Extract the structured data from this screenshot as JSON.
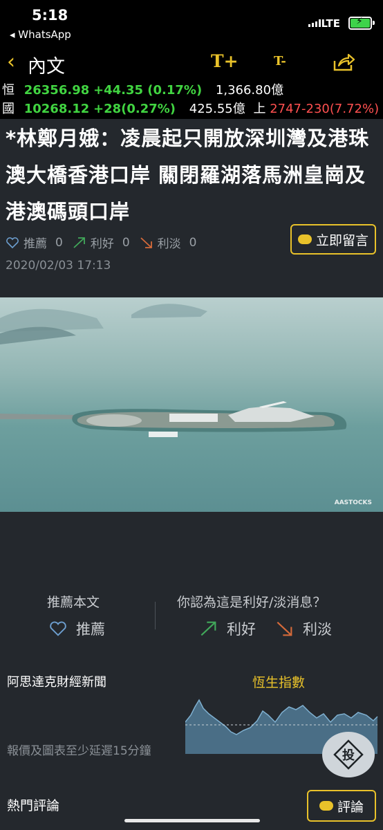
{
  "status_bar": {
    "time": "5:18",
    "back_app": "◂ WhatsApp",
    "network": "LTE"
  },
  "nav": {
    "back_glyph": "‹",
    "title": "內文",
    "font_larger": "T+",
    "font_smaller": "T-"
  },
  "ticker": {
    "hsi_label": "恒",
    "hsi_value": "26356.98",
    "hsi_change": "+44.35 (0.17%)",
    "hsi_turnover": "1,366.80億",
    "hscei_label": "國",
    "hscei_value": "10268.12",
    "hscei_change": "+28(0.27%)",
    "hscei_turnover": "425.55億",
    "sh_label": "上",
    "sh_value": "2747-230(7.72%)"
  },
  "article": {
    "headline": "*林鄭月娥：凌晨起只開放深圳灣及港珠澳大橋香港口岸 關閉羅湖落馬洲皇崗及港澳碼頭口岸",
    "recommend_label": "推薦",
    "recommend_count": "0",
    "bullish_label": "利好",
    "bullish_count": "0",
    "bearish_label": "利淡",
    "bearish_count": "0",
    "date": "2020/02/03 17:13",
    "comment_button": "立即留言",
    "photo_watermark": "AASTOCKS"
  },
  "vote": {
    "recommend_title": "推薦本文",
    "recommend_button": "推薦",
    "question": "你認為這是利好/淡消息？",
    "bullish_button": "利好",
    "bearish_button": "利淡"
  },
  "footer": {
    "source": "阿思達克財經新聞",
    "index_title": "恆生指數",
    "delay_note": "報價及圖表至少延遲15分鐘",
    "invest_button": "投",
    "hot_comments": "熱門評論",
    "comment_button": "評論"
  },
  "colors": {
    "accent": "#e9c22a",
    "up": "#41d441",
    "down": "#ff5050",
    "background": "#24282d"
  }
}
